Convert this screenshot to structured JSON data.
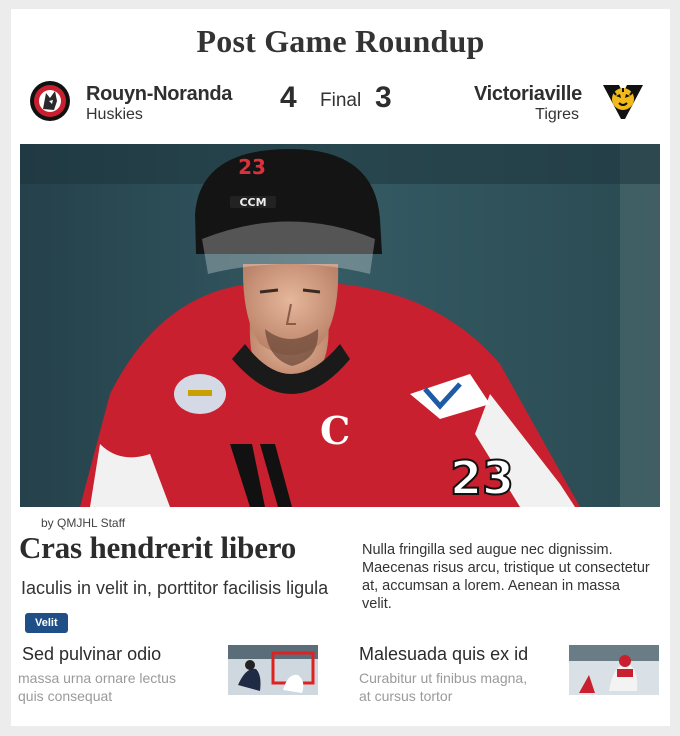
{
  "header": {
    "title": "Post Game Roundup"
  },
  "game": {
    "home": {
      "city": "Rouyn-Noranda",
      "nickname": "Huskies",
      "score": "4",
      "logo_icon": "huskies-logo-icon"
    },
    "away": {
      "city": "Victoriaville",
      "nickname": "Tigres",
      "score": "3",
      "logo_icon": "tigres-logo-icon"
    },
    "status": "Final"
  },
  "hero": {
    "jersey_number": "23",
    "helmet_brand": "CCM",
    "captain_letter": "C",
    "sleeve_number": "23"
  },
  "article": {
    "byline": "by QMJHL Staff",
    "headline": "Cras hendrerit libero",
    "subhead": "Iaculis in velit in, porttitor facilisis ligula",
    "summary": "Nulla fringilla sed augue nec dignissim. Maecenas risus arcu, tristique ut consectetur at, accumsan a lorem. Aenean in massa velit.",
    "tag": "Velit"
  },
  "stories": [
    {
      "title": "Sed pulvinar odio",
      "teaser": "massa urna ornare lectus quis consequat"
    },
    {
      "title": "Malesuada quis ex id",
      "teaser": "Curabitur ut finibus magna, at cursus tortor"
    }
  ],
  "colors": {
    "huskies_red": "#c8202e",
    "tag_blue": "#1f4f86",
    "tigres_gold": "#f2b91b"
  }
}
